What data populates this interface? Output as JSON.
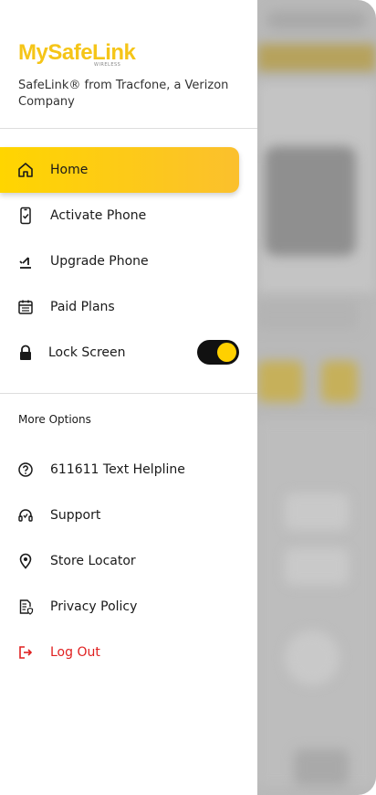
{
  "brand": {
    "logo_text": "MySafeLink",
    "logo_sub": "WIRELESS",
    "tagline": "SafeLink® from Tracfone, a Verizon Company",
    "accent_color": "#FFD500"
  },
  "menu": {
    "items": [
      {
        "label": "Home",
        "icon": "home-icon",
        "active": true
      },
      {
        "label": "Activate Phone",
        "icon": "activate-phone-icon"
      },
      {
        "label": "Upgrade Phone",
        "icon": "upgrade-phone-icon"
      },
      {
        "label": "Paid Plans",
        "icon": "calendar-icon"
      },
      {
        "label": "Lock Screen",
        "icon": "lock-icon",
        "toggle_on": true
      }
    ]
  },
  "more_options": {
    "title": "More Options",
    "items": [
      {
        "label": "611611 Text Helpline",
        "icon": "help-circle-icon"
      },
      {
        "label": "Support",
        "icon": "headset-icon"
      },
      {
        "label": "Store Locator",
        "icon": "location-pin-icon"
      },
      {
        "label": "Privacy Policy",
        "icon": "privacy-document-icon"
      },
      {
        "label": "Log Out",
        "icon": "logout-icon",
        "color": "#E02020"
      }
    ]
  }
}
